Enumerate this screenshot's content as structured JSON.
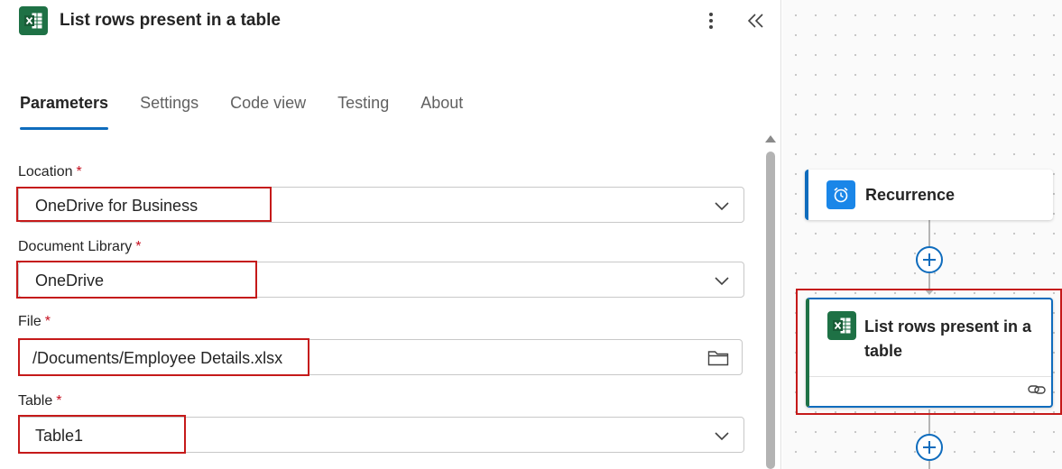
{
  "panel": {
    "title": "List rows present in a table",
    "header_icon": "excel-icon",
    "more_icon": "more-vertical-icon",
    "collapse_icon": "double-chevron-left-icon"
  },
  "tabs": [
    {
      "label": "Parameters",
      "active": true
    },
    {
      "label": "Settings",
      "active": false
    },
    {
      "label": "Code view",
      "active": false
    },
    {
      "label": "Testing",
      "active": false
    },
    {
      "label": "About",
      "active": false
    }
  ],
  "fields": {
    "location": {
      "label": "Location",
      "required_mark": "*",
      "value": "OneDrive for Business",
      "icon": "chevron-down-icon"
    },
    "document_library": {
      "label": "Document Library",
      "required_mark": "*",
      "value": "OneDrive",
      "icon": "chevron-down-icon"
    },
    "file": {
      "label": "File",
      "required_mark": "*",
      "value": "/Documents/Employee Details.xlsx",
      "icon": "folder-icon"
    },
    "table": {
      "label": "Table",
      "required_mark": "*",
      "value": "Table1",
      "icon": "chevron-down-icon"
    }
  },
  "canvas": {
    "nodes": [
      {
        "title": "Recurrence",
        "icon": "alarm-clock-icon"
      },
      {
        "title_line1": "List rows present in a",
        "title_line2": "table",
        "icon": "excel-icon",
        "footer_icon": "link-icon"
      }
    ],
    "add_icon": "plus-circle-icon"
  },
  "colors": {
    "accent": "#0f6cbd",
    "excel_green": "#1e7145",
    "recurrence_blue": "#1a86e8",
    "required_red": "#c50f1f",
    "highlight_red": "#c51a1a"
  }
}
